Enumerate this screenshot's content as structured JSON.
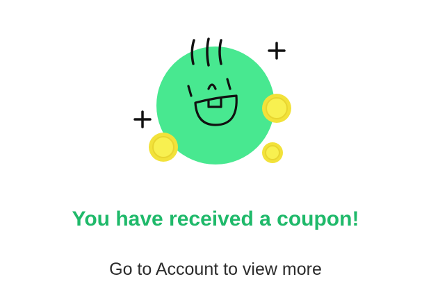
{
  "illustration": {
    "icon": "happy-coupon-face-icon",
    "colors": {
      "face": "#48e890",
      "coin_outer": "#f2e23a",
      "coin_inner": "#f8f050",
      "stroke": "#111111"
    }
  },
  "message": {
    "title": "You have received a coupon!",
    "subtitle": "Go to Account to view more"
  },
  "colors": {
    "title": "#1fb96a",
    "subtitle": "#2b2b2b",
    "background": "#ffffff"
  }
}
